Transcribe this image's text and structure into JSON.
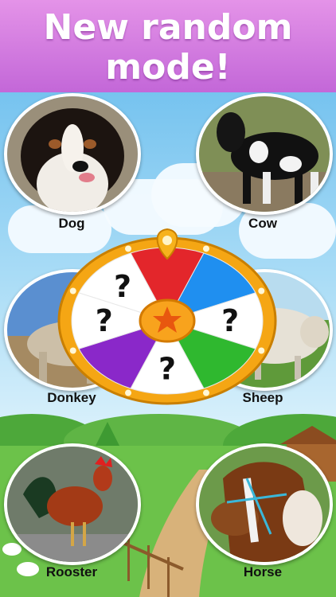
{
  "header": {
    "title_line1": "New random",
    "title_line2": "mode!"
  },
  "animals": [
    {
      "name": "Dog"
    },
    {
      "name": "Cow"
    },
    {
      "name": "Donkey"
    },
    {
      "name": "Sheep"
    },
    {
      "name": "Rooster"
    },
    {
      "name": "Horse"
    }
  ],
  "wheel": {
    "segment_symbol": "?",
    "segments": [
      {
        "color": "#e3262b"
      },
      {
        "color": "#1f8ff0"
      },
      {
        "color": "#ffffff"
      },
      {
        "color": "#2fb82f"
      },
      {
        "color": "#ffffff"
      },
      {
        "color": "#8a28c9"
      },
      {
        "color": "#ffffff"
      },
      {
        "color": "#ffffff"
      }
    ],
    "rim_color": "#f5a614",
    "center_icon": "star-icon",
    "pointer_icon": "map-pin-icon"
  }
}
